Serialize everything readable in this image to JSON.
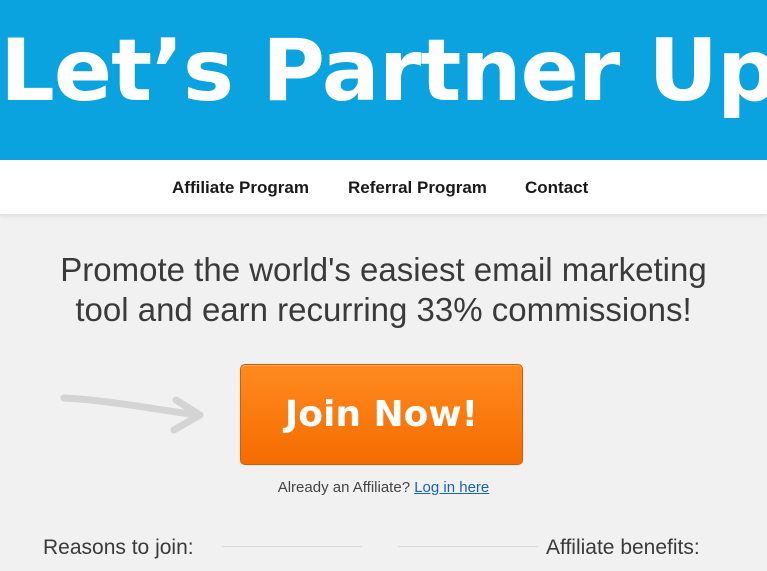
{
  "header": {
    "title": "Let’s Partner Up!",
    "background_color": "#0aa3df"
  },
  "nav": {
    "items": [
      {
        "label": "Affiliate Program"
      },
      {
        "label": "Referral Program"
      },
      {
        "label": "Contact"
      }
    ]
  },
  "main": {
    "headline_line1": "Promote the world's easiest email marketing",
    "headline_line2": "tool and earn recurring 33% commissions!",
    "join_button_label": "Join Now!",
    "join_button_color": "#f97a10",
    "already_text": "Already an Affiliate?",
    "login_link_label": "Log in here",
    "reasons_heading": "Reasons to join:",
    "benefits_heading": "Affiliate benefits:"
  },
  "icons": {
    "arrow": "arrow-right-icon"
  }
}
